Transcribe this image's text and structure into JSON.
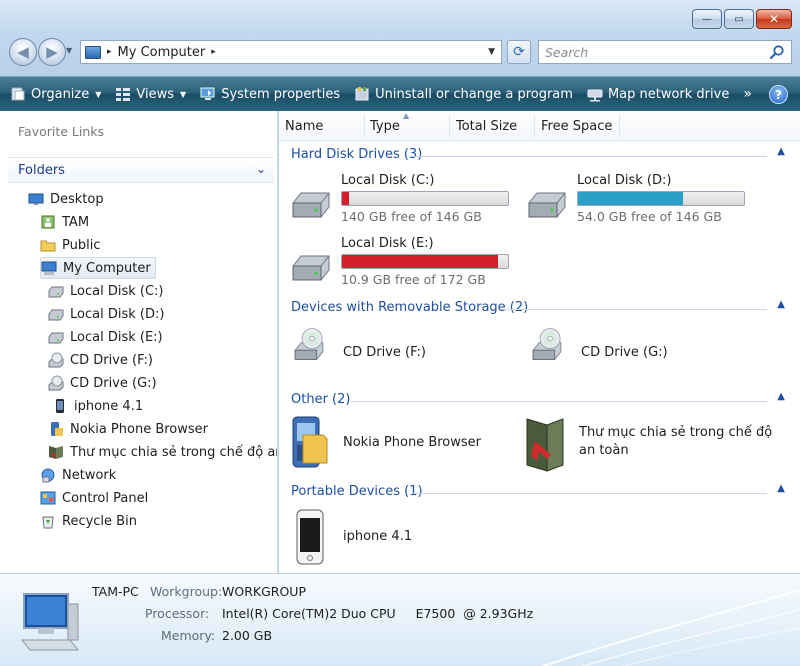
{
  "window": {
    "controls": {
      "minimize": "—",
      "maximize": "▭",
      "close": "✕"
    }
  },
  "address_bar": {
    "crumb": "My Computer",
    "separator": "▸"
  },
  "search": {
    "placeholder": "Search"
  },
  "toolbar": {
    "organize": "Organize",
    "views": "Views",
    "system_properties": "System properties",
    "uninstall": "Uninstall or change a program",
    "map_drive": "Map network drive",
    "more": "»",
    "help": "?"
  },
  "nav_pane": {
    "favorite_links": "Favorite Links",
    "folders": "Folders",
    "tree": [
      {
        "label": "Desktop",
        "icon": "desktop-icon"
      },
      {
        "label": "TAM",
        "icon": "user-folder-icon"
      },
      {
        "label": "Public",
        "icon": "folder-icon"
      },
      {
        "label": "My Computer",
        "icon": "computer-icon",
        "selected": true
      },
      {
        "label": "Local Disk (C:)",
        "icon": "hard-disk-icon"
      },
      {
        "label": "Local Disk (D:)",
        "icon": "hard-disk-icon"
      },
      {
        "label": "Local Disk (E:)",
        "icon": "hard-disk-icon"
      },
      {
        "label": "CD Drive (F:)",
        "icon": "cd-drive-icon"
      },
      {
        "label": "CD Drive (G:)",
        "icon": "cd-drive-icon"
      },
      {
        "label": "iphone 4.1",
        "icon": "phone-icon"
      },
      {
        "label": "Nokia Phone Browser",
        "icon": "nokia-browser-icon"
      },
      {
        "label": "Thư mục chia sẻ trong chế độ an toà",
        "icon": "shared-folder-icon"
      },
      {
        "label": "Network",
        "icon": "network-icon"
      },
      {
        "label": "Control Panel",
        "icon": "control-panel-icon"
      },
      {
        "label": "Recycle Bin",
        "icon": "recycle-bin-icon"
      }
    ]
  },
  "columns": [
    "Name",
    "Type",
    "Total Size",
    "Free Space"
  ],
  "groups": {
    "hard_disks": "Hard Disk Drives (3)",
    "removable": "Devices with Removable Storage (2)",
    "other": "Other (2)",
    "portable": "Portable Devices (1)"
  },
  "drives": [
    {
      "name": "Local Disk (C:)",
      "free_text": "140 GB  free of 146 GB",
      "used_fraction": 0.041,
      "bar_color": "#d21f2a"
    },
    {
      "name": "Local Disk (D:)",
      "free_text": "54.0 GB free of 146 GB",
      "used_fraction": 0.63,
      "bar_color": "#2a9fc8"
    },
    {
      "name": "Local Disk (E:)",
      "free_text": "10.9 GB free of 172 GB",
      "used_fraction": 0.937,
      "bar_color": "#d21f2a"
    }
  ],
  "removable": [
    {
      "name": "CD Drive (F:)"
    },
    {
      "name": "CD Drive (G:)"
    }
  ],
  "other": [
    {
      "name": "Nokia Phone Browser"
    },
    {
      "name_line1": "Thư mục chia sẻ trong chế độ",
      "name_line2": "an toàn"
    }
  ],
  "portable": [
    {
      "name": "iphone 4.1"
    }
  ],
  "details": {
    "computer_name": "TAM-PC",
    "workgroup_label": "Workgroup:",
    "workgroup": "WORKGROUP",
    "processor_label": "Processor:",
    "processor": "Intel(R) Core(TM)2 Duo CPU     E7500  @ 2.93GHz",
    "memory_label": "Memory:",
    "memory": "2.00 GB"
  }
}
